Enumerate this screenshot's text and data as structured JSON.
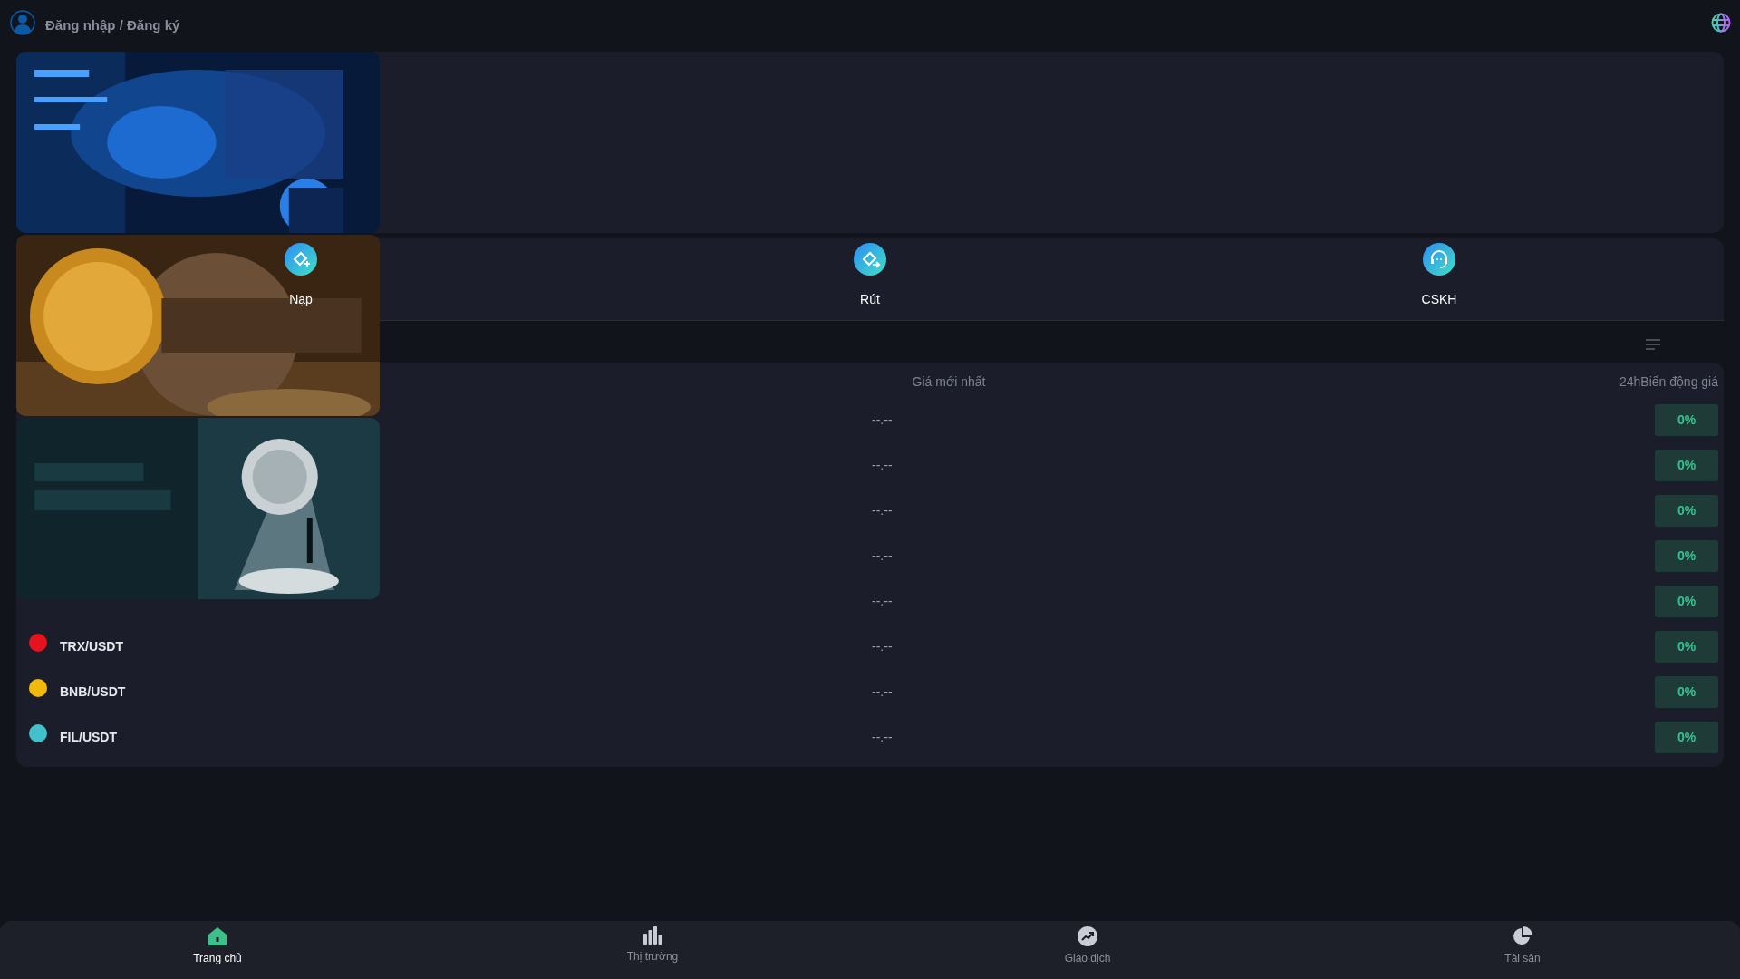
{
  "header": {
    "login_link": "Đăng nhập / Đăng ký"
  },
  "actions": [
    {
      "kind": "deposit",
      "label": "Nạp"
    },
    {
      "kind": "withdraw",
      "label": "Rút"
    },
    {
      "kind": "support",
      "label": "CSKH"
    }
  ],
  "market": {
    "columns": [
      "Giá mới nhất",
      "24hBiến động giá"
    ],
    "rows": [
      {
        "price": "--.--",
        "change": "0%"
      },
      {
        "price": "--.--",
        "change": "0%"
      },
      {
        "price": "--.--",
        "change": "0%"
      },
      {
        "price": "--.--",
        "change": "0%"
      },
      {
        "price": "--.--",
        "change": "0%"
      },
      {
        "pair": "TRX/USDT",
        "color": "#e5131d",
        "price": "--.--",
        "change": "0%"
      },
      {
        "pair": "BNB/USDT",
        "color": "#f0b90b",
        "price": "--.--",
        "change": "0%"
      },
      {
        "pair": "FIL/USDT",
        "color": "#42c1ca",
        "price": "--.--",
        "change": "0%"
      }
    ]
  },
  "bottom_nav": [
    {
      "kind": "home",
      "label": "Trang chủ",
      "selected": true
    },
    {
      "kind": "market",
      "label": "Thị trường",
      "selected": false
    },
    {
      "kind": "trade",
      "label": "Giao dịch",
      "selected": false
    },
    {
      "kind": "assets",
      "label": "Tài sản",
      "selected": false
    }
  ]
}
